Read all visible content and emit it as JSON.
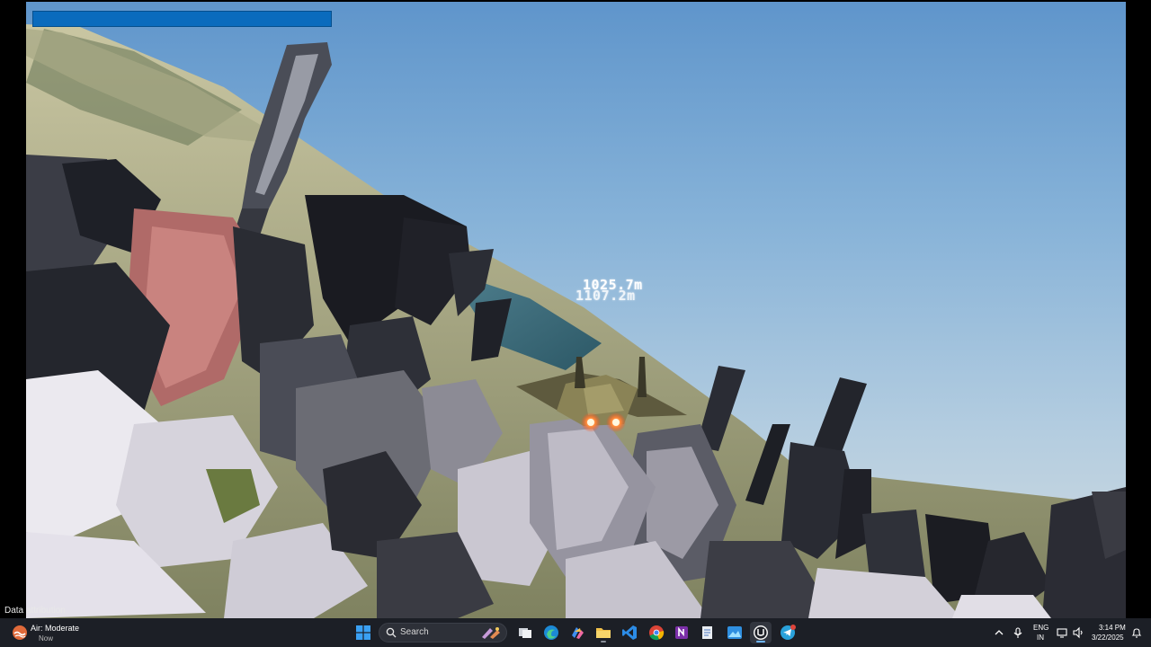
{
  "game": {
    "hud_distance_primary": "1025.7m",
    "hud_distance_secondary": "1107.2m",
    "data_attribution": "Data attribution"
  },
  "taskbar": {
    "weather": {
      "title": "Air: Moderate",
      "subtitle": "Now"
    },
    "search_label": "Search",
    "apps": [
      {
        "name": "task-view-icon"
      },
      {
        "name": "edge-icon"
      },
      {
        "name": "copilot-icon"
      },
      {
        "name": "file-explorer-icon"
      },
      {
        "name": "vscode-icon"
      },
      {
        "name": "chrome-icon"
      },
      {
        "name": "onenote-icon"
      },
      {
        "name": "notepad-icon"
      },
      {
        "name": "photos-icon"
      },
      {
        "name": "unreal-engine-icon"
      },
      {
        "name": "telegram-icon"
      }
    ],
    "tray": {
      "language_line1": "ENG",
      "language_line2": "IN",
      "time": "3:14 PM",
      "date": "3/22/2025"
    }
  },
  "colors": {
    "loading_bar": "#0a6bbd",
    "taskbar_bg": "#1c1f26",
    "sky_top": "#5f95cb",
    "sky_bottom": "#d5dde0"
  }
}
